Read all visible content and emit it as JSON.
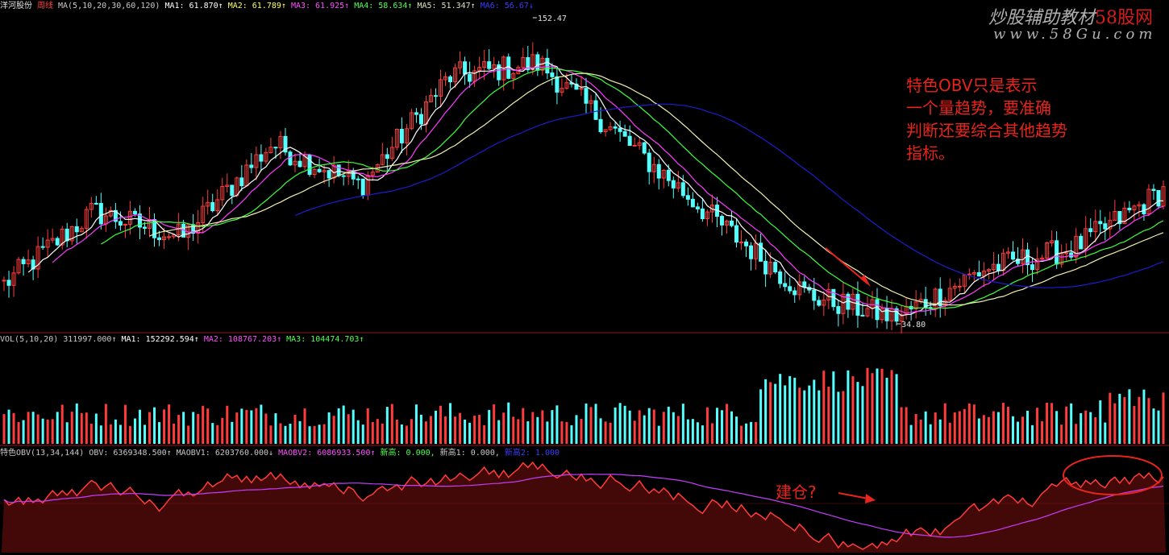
{
  "price_header": {
    "stock_name": "洋河股份",
    "period": "周线",
    "ma_label": "MA(5,10,20,30,60,120)",
    "ma1": "MA1: 61.870↑",
    "ma2": "MA2: 61.789↑",
    "ma3": "MA3: 61.925↑",
    "ma4": "MA4: 58.634↑",
    "ma5": "MA5: 51.347↑",
    "ma6": "MA6: 56.67↓"
  },
  "vol_header": {
    "label": "VOL(5,10,20)",
    "vol": "311997.000↑",
    "ma1": "MA1: 152292.594↑",
    "ma2": "MA2: 108767.203↑",
    "ma3": "MA3: 104474.703↑"
  },
  "obv_header": {
    "label": "特色OBV(13,34,144)",
    "obv": "OBV: 6369348.500↑",
    "maobv1": "MAOBV1: 6203760.000↓",
    "maobv2": "MAOBV2: 6086933.500↑",
    "xingao": "新高: 0.000,",
    "xingao1": "新高1: 0.000,",
    "xingao2": "新高2: 1.000"
  },
  "watermark": {
    "line1": "炒股辅助教材",
    "brand": "58股网",
    "line2": "www.58Gu.com"
  },
  "annotations": {
    "note_lines": [
      "特色OBV只是表示",
      "一个量趋势，要准确",
      "判断还要综合其他趋势",
      "指标。"
    ],
    "build_position": "建仓?"
  },
  "colors": {
    "up": "#ff3c3c",
    "down": "#54ffff",
    "ma_white": "#ffffff",
    "ma_magenta": "#ff3cff",
    "ma_green": "#3cff3c",
    "ma_cream": "#f0f0b0",
    "ma_blue": "#1c1cd0",
    "obv_magenta": "#c83cff",
    "obv_green": "#3cff3c",
    "annotation_red": "#e8241c"
  },
  "chart_data": [
    {
      "type": "candlestick",
      "title": "洋河股份 周线",
      "x": "weekly",
      "y_range": [
        34.8,
        152.47
      ],
      "annotations": [
        {
          "label": "152.47",
          "kind": "high"
        },
        {
          "label": "34.80",
          "kind": "low"
        }
      ],
      "ohlc_keypoints": [
        {
          "o": 48,
          "h": 52,
          "l": 45,
          "c": 50
        },
        {
          "o": 65,
          "h": 82,
          "l": 62,
          "c": 78
        },
        {
          "o": 72,
          "h": 78,
          "l": 64,
          "c": 68
        },
        {
          "o": 80,
          "h": 108,
          "l": 78,
          "c": 104
        },
        {
          "o": 92,
          "h": 98,
          "l": 84,
          "c": 88
        },
        {
          "o": 118,
          "h": 135,
          "l": 112,
          "c": 130
        },
        {
          "o": 140,
          "h": 152.47,
          "l": 130,
          "c": 135
        },
        {
          "o": 120,
          "h": 126,
          "l": 100,
          "c": 104
        },
        {
          "o": 80,
          "h": 86,
          "l": 70,
          "c": 74
        },
        {
          "o": 50,
          "h": 54,
          "l": 44,
          "c": 46
        },
        {
          "o": 38,
          "h": 40,
          "l": 34.8,
          "c": 37
        },
        {
          "o": 52,
          "h": 58,
          "l": 50,
          "c": 56
        },
        {
          "o": 60,
          "h": 66,
          "l": 56,
          "c": 64
        },
        {
          "o": 78,
          "h": 90,
          "l": 74,
          "c": 86
        }
      ],
      "series": [
        {
          "name": "MA1"
        },
        {
          "name": "MA2"
        },
        {
          "name": "MA3"
        },
        {
          "name": "MA4"
        },
        {
          "name": "MA5"
        },
        {
          "name": "MA6"
        }
      ]
    },
    {
      "type": "bar",
      "title": "VOL(5,10,20)",
      "series": [
        {
          "name": "VOL",
          "last": 311997.0
        },
        {
          "name": "MA1",
          "last": 152292.594
        },
        {
          "name": "MA2",
          "last": 108767.203
        },
        {
          "name": "MA3",
          "last": 104474.703
        }
      ]
    },
    {
      "type": "area",
      "title": "特色OBV(13,34,144)",
      "series": [
        {
          "name": "OBV",
          "last": 6369348.5
        },
        {
          "name": "MAOBV1",
          "last": 6203760.0
        },
        {
          "name": "MAOBV2",
          "last": 6086933.5
        }
      ]
    }
  ]
}
